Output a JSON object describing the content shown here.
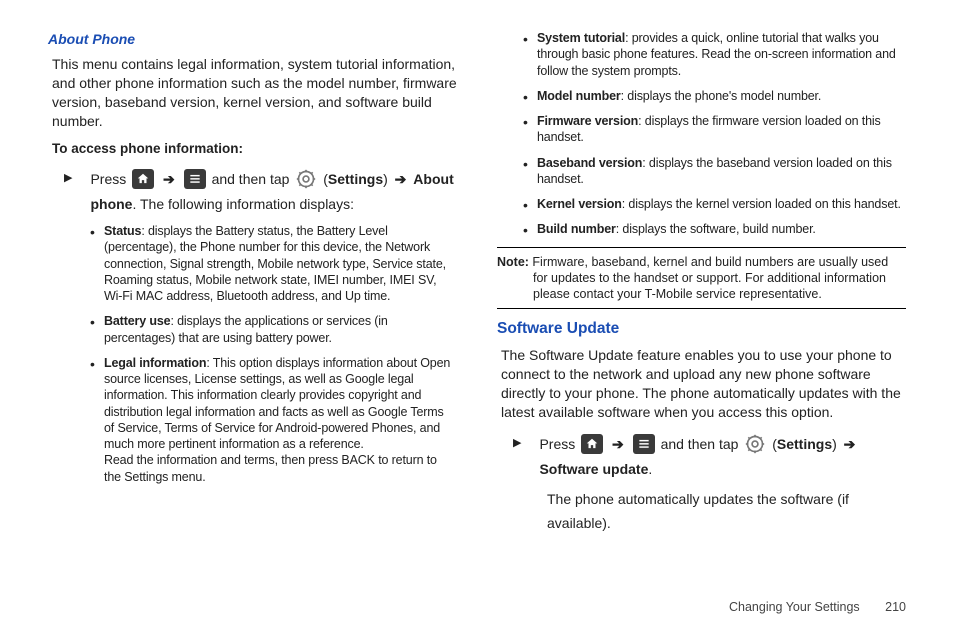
{
  "left": {
    "heading": "About Phone",
    "intro": "This menu contains legal information, system tutorial information, and other phone information such as the model number, firmware version, baseband version, kernel version, and software build number.",
    "access_label": "To access phone information:",
    "step_press": "Press",
    "step_andthentap": "and then tap",
    "step_settings": "Settings",
    "step_about": "About phone",
    "step_tail": ". The following information displays:",
    "bullets": {
      "status_b": "Status",
      "status_t": ": displays the Battery status, the Battery Level (percentage), the Phone number for this device, the Network connection, Signal strength, Mobile network type, Service state, Roaming status, Mobile network state, IMEI number, IMEI SV, Wi-Fi MAC address, Bluetooth address, and Up time.",
      "battery_b": "Battery use",
      "battery_t": ": displays the applications or services (in percentages) that are using battery power.",
      "legal_b": "Legal information",
      "legal_t1": ": This option displays information about Open source licenses, License settings, as well as Google legal information. This information clearly provides copyright and distribution legal information and facts as well as Google Terms of Service, Terms of Service for Android-powered Phones, and much more pertinent information as a reference.",
      "legal_t2": "Read the information and terms, then press BACK to return to the Settings menu."
    }
  },
  "right": {
    "bullets": {
      "tutorial_b": "System tutorial",
      "tutorial_t": ": provides a quick, online tutorial that walks you through basic phone features. Read the on-screen information and follow the system prompts.",
      "model_b": "Model number",
      "model_t": ": displays the phone's model number.",
      "firmware_b": "Firmware version",
      "firmware_t": ": displays the firmware version loaded on this handset.",
      "baseband_b": "Baseband version",
      "baseband_t": ": displays the baseband version loaded on this handset.",
      "kernel_b": "Kernel version",
      "kernel_t": ": displays the kernel version loaded on this handset.",
      "build_b": "Build number",
      "build_t": ": displays the software, build number."
    },
    "note_b": "Note:",
    "note_t": " Firmware, baseband, kernel and build numbers are usually used for updates to the handset or support. For additional information please contact your T-Mobile service representative.",
    "sw_heading": "Software Update",
    "sw_intro": "The Software Update feature enables you to use your phone to connect to the network and upload any new phone software directly to your phone. The phone automatically updates with the latest available software when you access this option.",
    "sw_step_press": "Press",
    "sw_step_andthentap": "and then tap",
    "sw_step_settings": "Settings",
    "sw_step_update": "Software update",
    "sw_step_tail": "The phone automatically updates the software (if available)."
  },
  "footer": {
    "section": "Changing Your Settings",
    "page": "210"
  }
}
